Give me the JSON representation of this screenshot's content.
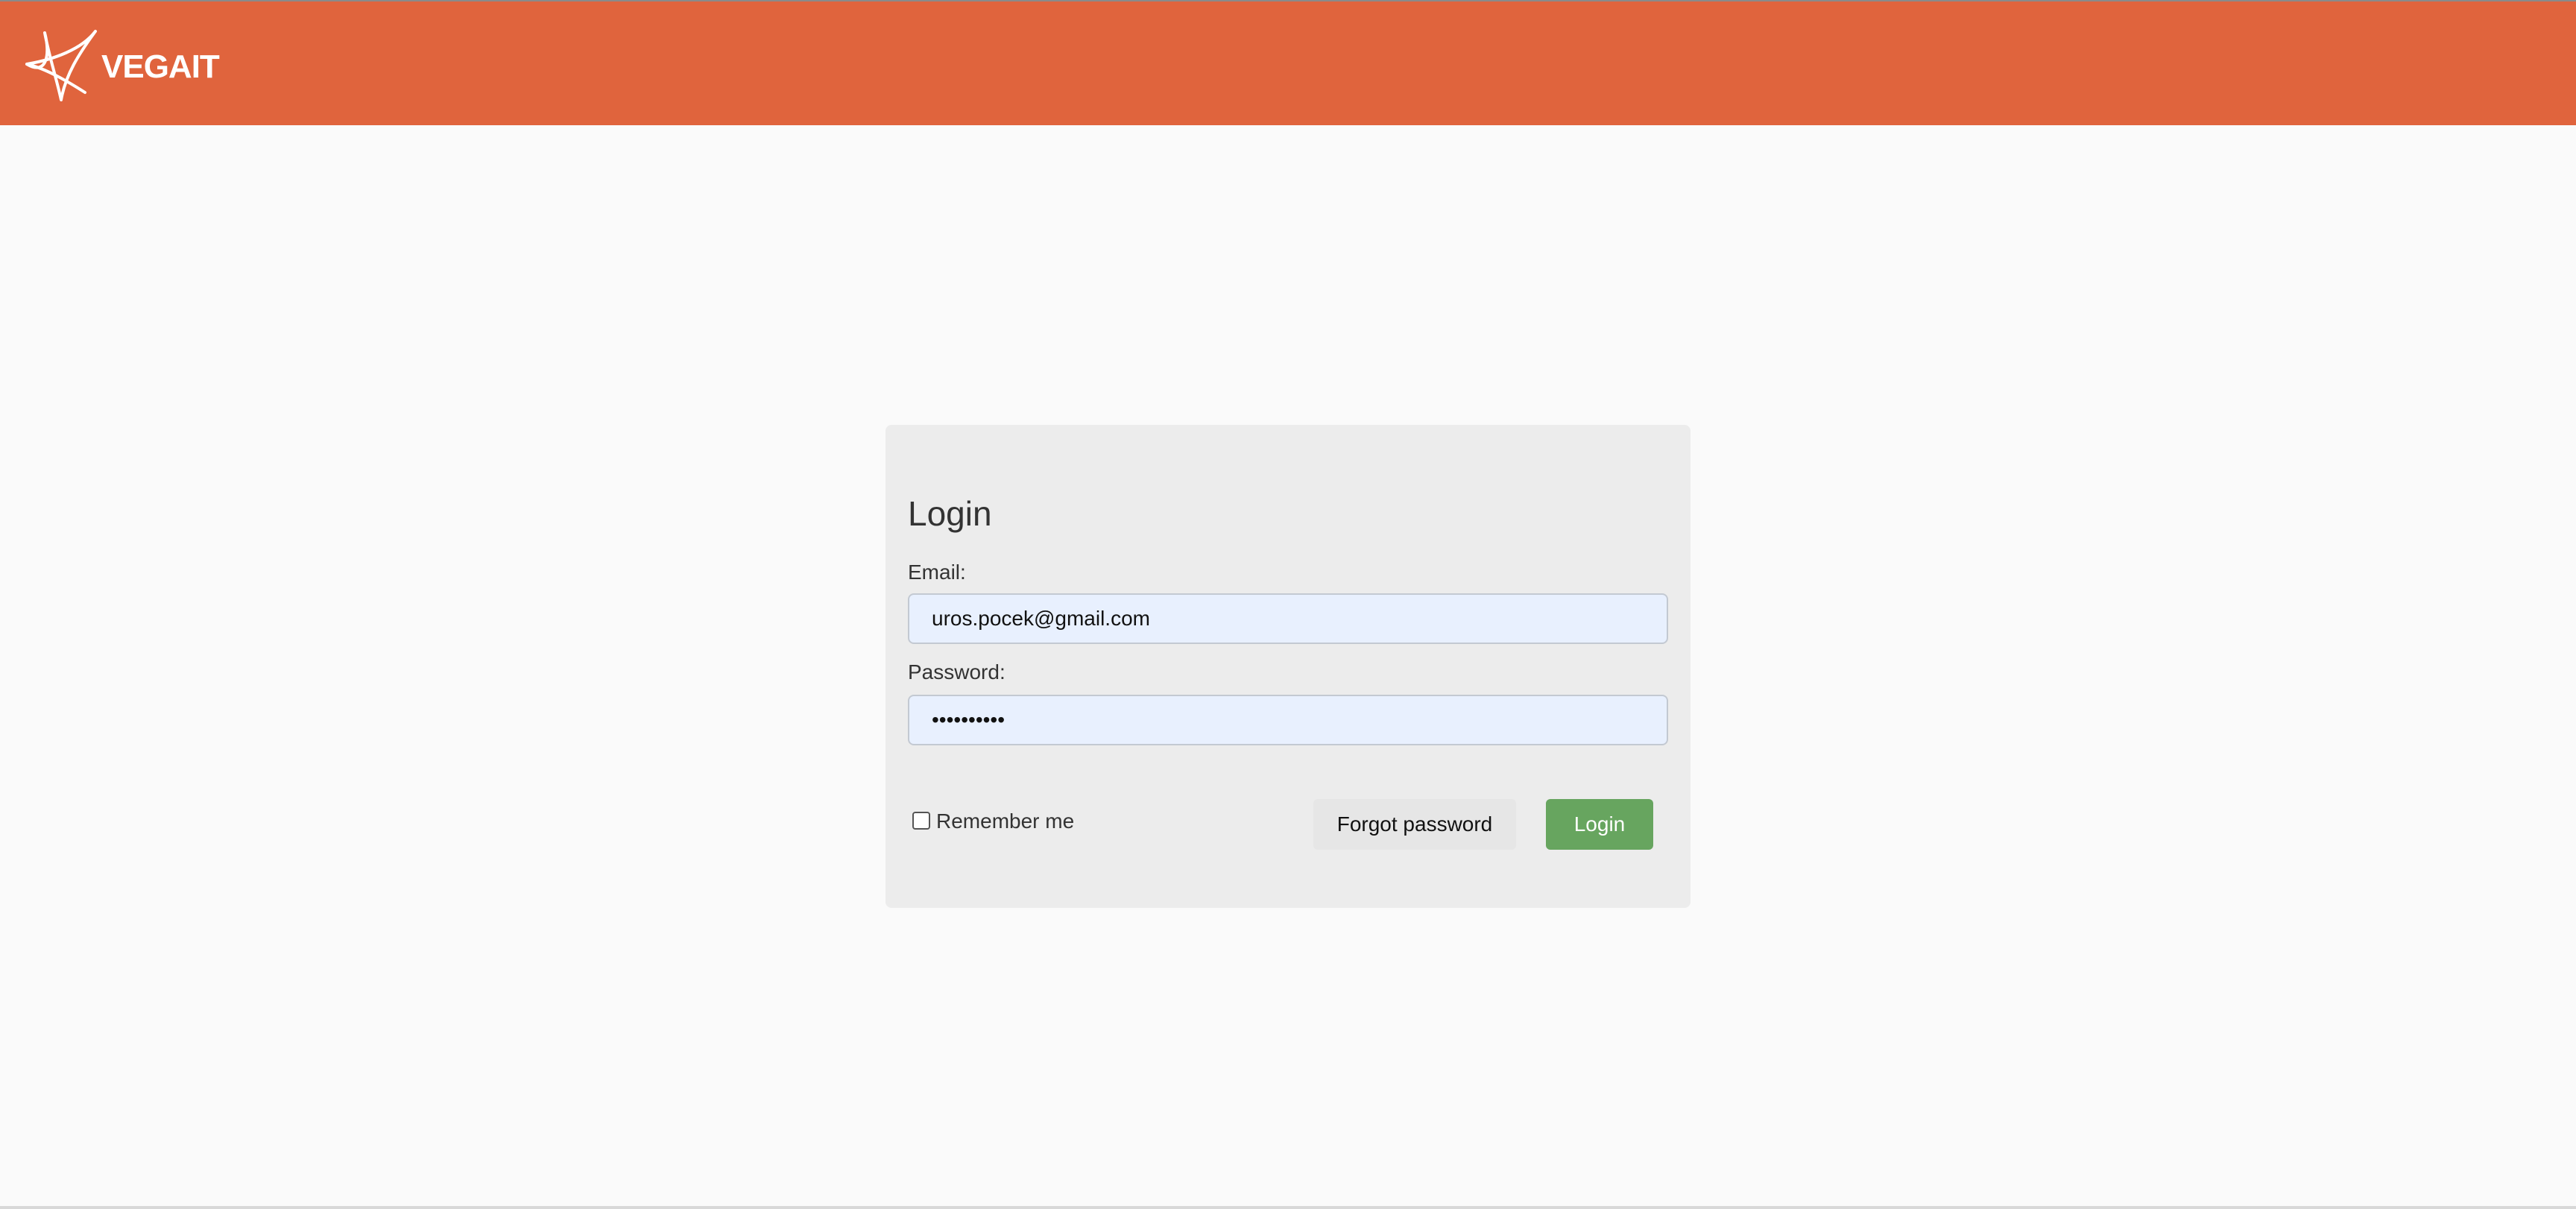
{
  "header": {
    "brand": "VEGAIT",
    "logo_icon": "star-logo-icon",
    "background_color": "#e0643d"
  },
  "login": {
    "title": "Login",
    "email_label": "Email:",
    "email_value": "uros.pocek@gmail.com",
    "password_label": "Password:",
    "password_value": "••••••••••",
    "remember_label": "Remember me",
    "remember_checked": false,
    "forgot_label": "Forgot password",
    "login_label": "Login",
    "input_background": "#e8f0fe",
    "login_button_color": "#67a55f"
  }
}
